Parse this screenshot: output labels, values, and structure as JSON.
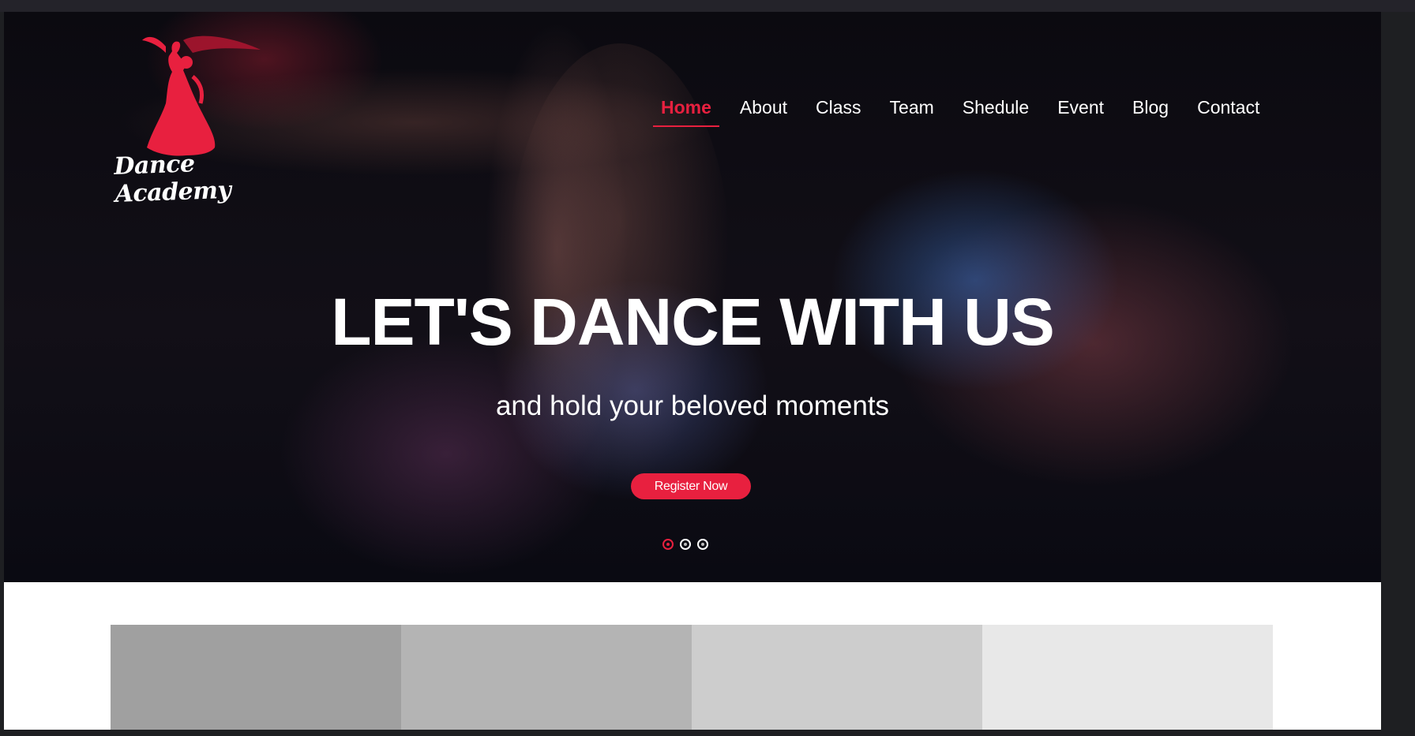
{
  "brand": {
    "name": "Dance Academy",
    "accent_color": "#e8203f"
  },
  "nav": {
    "items": [
      {
        "label": "Home",
        "active": true
      },
      {
        "label": "About"
      },
      {
        "label": "Class"
      },
      {
        "label": "Team"
      },
      {
        "label": "Shedule"
      },
      {
        "label": "Event"
      },
      {
        "label": "Blog"
      },
      {
        "label": "Contact"
      }
    ]
  },
  "hero": {
    "headline": "LET'S DANCE WITH US",
    "subheadline": "and hold your beloved moments",
    "cta_label": "Register Now",
    "slides_count": 3,
    "active_slide": 1
  },
  "gallery": {
    "tile_colors": [
      "#a0a0a0",
      "#b4b4b4",
      "#cdcdcd",
      "#e8e8e8"
    ]
  }
}
